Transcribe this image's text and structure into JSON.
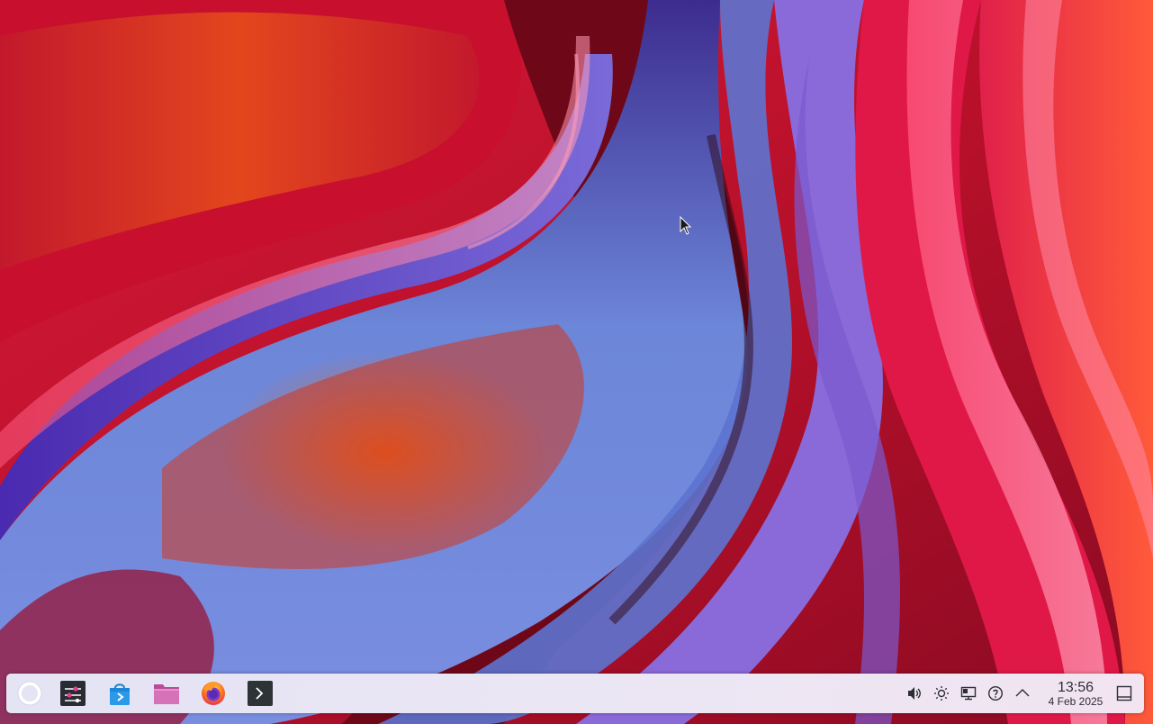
{
  "desktop": {
    "wallpaper_name": "abstract-flowing-silk-wallpaper",
    "colors": {
      "crimson": "#c8102e",
      "orange": "#e8501a",
      "violet": "#5a2dbf",
      "periwinkle": "#6c86d8",
      "pink": "#ff7aa0",
      "dark_maroon": "#3a0a18"
    }
  },
  "panel": {
    "background": "#e8e6f4",
    "launchers": [
      {
        "name": "application-launcher",
        "icon": "circle-ring-icon"
      },
      {
        "name": "system-settings",
        "icon": "sliders-icon"
      },
      {
        "name": "discover-store",
        "icon": "shopping-bag-icon"
      },
      {
        "name": "file-manager",
        "icon": "folder-icon"
      },
      {
        "name": "firefox",
        "icon": "firefox-icon"
      },
      {
        "name": "terminal",
        "icon": "terminal-icon"
      }
    ],
    "tray": {
      "icons": [
        "volume-icon",
        "brightness-icon",
        "network-icon",
        "updates-icon",
        "chevron-up-icon"
      ]
    },
    "clock": {
      "time": "13:56",
      "date": "4 Feb 2025"
    },
    "show_desktop_icon": "show-desktop-icon"
  }
}
